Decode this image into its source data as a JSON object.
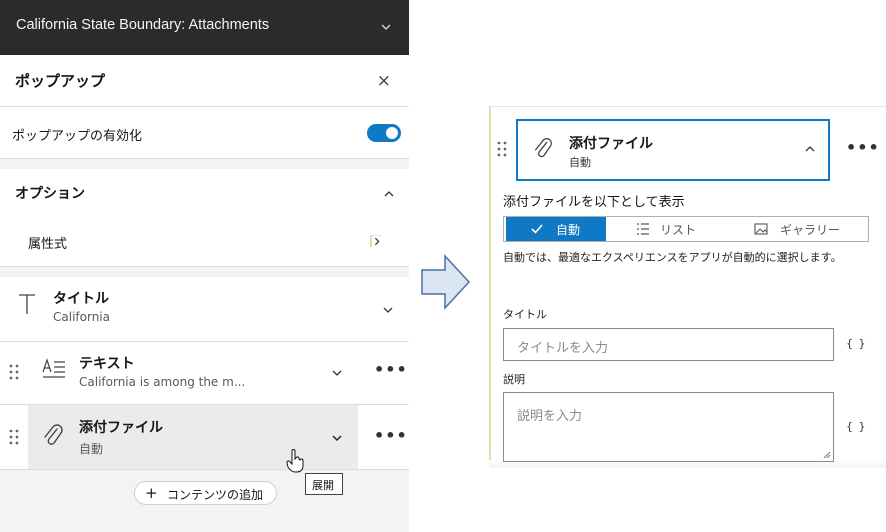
{
  "left_panel": {
    "header_title": "California State Boundary: Attachments",
    "popup_title": "ポップアップ",
    "close_symbol": "×",
    "enable_popup_label": "ポップアップの有効化",
    "enable_popup_on": true,
    "options_title": "オプション",
    "attribute_expressions_label": "属性式",
    "items": [
      {
        "label": "タイトル",
        "sub": "California"
      },
      {
        "label": "テキスト",
        "sub": "California is among the m..."
      },
      {
        "label": "添付ファイル",
        "sub": "自動"
      }
    ],
    "add_content_label": "コンテンツの追加",
    "tooltip": "展開"
  },
  "right_panel": {
    "card_title": "添付ファイル",
    "card_sub": "自動",
    "show_as_label": "添付ファイルを以下として表示",
    "options": [
      "自動",
      "リスト",
      "ギャラリー"
    ],
    "selected_option": "自動",
    "description": "自動では、最適なエクスペリエンスをアプリが自動的に選択します。",
    "title_label": "タイトル",
    "title_placeholder": "タイトルを入力",
    "caption_label": "説明",
    "caption_placeholder": "説明を入力",
    "expression_symbol": "{ }"
  },
  "colors": {
    "accent": "#0f79c5",
    "header_bg": "#2b2b2b",
    "arrow_fill": "#dce6f2",
    "arrow_stroke": "#4a6fa5"
  },
  "icons": {
    "header": "chevron-down-icon",
    "close": "close-icon",
    "options": "chevron-up-icon",
    "attr": "chevron-right-icon",
    "title_item": "text-title-icon",
    "text_item": "text-paragraph-icon",
    "attach_item": "paperclip-icon",
    "grip": "drag-handle-icon",
    "more": "more-icon",
    "list": "list-icon",
    "gallery": "image-icon",
    "check": "check-icon"
  }
}
